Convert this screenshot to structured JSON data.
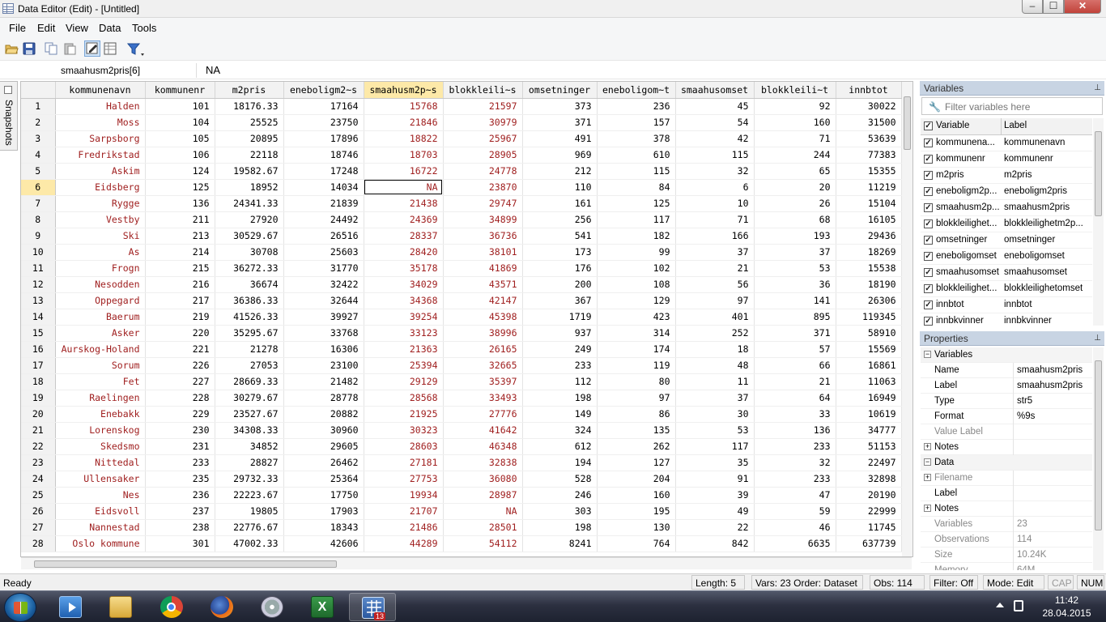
{
  "window": {
    "title": "Data Editor (Edit) - [Untitled]",
    "minimize_glyph": "–",
    "maximize_glyph": "☐",
    "close_glyph": "✕"
  },
  "menu": [
    "File",
    "Edit",
    "View",
    "Data",
    "Tools"
  ],
  "toolbar": {
    "icons": [
      "open-icon",
      "save-icon",
      "copy-icon",
      "paste-icon",
      "edit-mode-icon",
      "browse-mode-icon",
      "filter-icon"
    ]
  },
  "formula": {
    "varname": "smaahusm2pris[6]",
    "value": "NA"
  },
  "snapshots_label": "Snapshots",
  "grid": {
    "columns": [
      "kommunenavn",
      "kommunenr",
      "m2pris",
      "eneboligm2~s",
      "smaahusm2p~s",
      "blokkleili~s",
      "omsetninger",
      "eneboligom~t",
      "smaahusomset",
      "blokkleili~t",
      "innbtot"
    ],
    "selected_column": 4,
    "selected_row": 5,
    "rows": [
      [
        "1",
        "Halden",
        "101",
        "18176.33",
        "17164",
        "15768",
        "21597",
        "373",
        "236",
        "45",
        "92",
        "30022"
      ],
      [
        "2",
        "Moss",
        "104",
        "25525",
        "23750",
        "21846",
        "30979",
        "371",
        "157",
        "54",
        "160",
        "31500"
      ],
      [
        "3",
        "Sarpsborg",
        "105",
        "20895",
        "17896",
        "18822",
        "25967",
        "491",
        "378",
        "42",
        "71",
        "53639"
      ],
      [
        "4",
        "Fredrikstad",
        "106",
        "22118",
        "18746",
        "18703",
        "28905",
        "969",
        "610",
        "115",
        "244",
        "77383"
      ],
      [
        "5",
        "Askim",
        "124",
        "19582.67",
        "17248",
        "16722",
        "24778",
        "212",
        "115",
        "32",
        "65",
        "15355"
      ],
      [
        "6",
        "Eidsberg",
        "125",
        "18952",
        "14034",
        "NA",
        "23870",
        "110",
        "84",
        "6",
        "20",
        "11219"
      ],
      [
        "7",
        "Rygge",
        "136",
        "24341.33",
        "21839",
        "21438",
        "29747",
        "161",
        "125",
        "10",
        "26",
        "15104"
      ],
      [
        "8",
        "Vestby",
        "211",
        "27920",
        "24492",
        "24369",
        "34899",
        "256",
        "117",
        "71",
        "68",
        "16105"
      ],
      [
        "9",
        "Ski",
        "213",
        "30529.67",
        "26516",
        "28337",
        "36736",
        "541",
        "182",
        "166",
        "193",
        "29436"
      ],
      [
        "10",
        "As",
        "214",
        "30708",
        "25603",
        "28420",
        "38101",
        "173",
        "99",
        "37",
        "37",
        "18269"
      ],
      [
        "11",
        "Frogn",
        "215",
        "36272.33",
        "31770",
        "35178",
        "41869",
        "176",
        "102",
        "21",
        "53",
        "15538"
      ],
      [
        "12",
        "Nesodden",
        "216",
        "36674",
        "32422",
        "34029",
        "43571",
        "200",
        "108",
        "56",
        "36",
        "18190"
      ],
      [
        "13",
        "Oppegard",
        "217",
        "36386.33",
        "32644",
        "34368",
        "42147",
        "367",
        "129",
        "97",
        "141",
        "26306"
      ],
      [
        "14",
        "Baerum",
        "219",
        "41526.33",
        "39927",
        "39254",
        "45398",
        "1719",
        "423",
        "401",
        "895",
        "119345"
      ],
      [
        "15",
        "Asker",
        "220",
        "35295.67",
        "33768",
        "33123",
        "38996",
        "937",
        "314",
        "252",
        "371",
        "58910"
      ],
      [
        "16",
        "Aurskog-Holand",
        "221",
        "21278",
        "16306",
        "21363",
        "26165",
        "249",
        "174",
        "18",
        "57",
        "15569"
      ],
      [
        "17",
        "Sorum",
        "226",
        "27053",
        "23100",
        "25394",
        "32665",
        "233",
        "119",
        "48",
        "66",
        "16861"
      ],
      [
        "18",
        "Fet",
        "227",
        "28669.33",
        "21482",
        "29129",
        "35397",
        "112",
        "80",
        "11",
        "21",
        "11063"
      ],
      [
        "19",
        "Raelingen",
        "228",
        "30279.67",
        "28778",
        "28568",
        "33493",
        "198",
        "97",
        "37",
        "64",
        "16949"
      ],
      [
        "20",
        "Enebakk",
        "229",
        "23527.67",
        "20882",
        "21925",
        "27776",
        "149",
        "86",
        "30",
        "33",
        "10619"
      ],
      [
        "21",
        "Lorenskog",
        "230",
        "34308.33",
        "30960",
        "30323",
        "41642",
        "324",
        "135",
        "53",
        "136",
        "34777"
      ],
      [
        "22",
        "Skedsmo",
        "231",
        "34852",
        "29605",
        "28603",
        "46348",
        "612",
        "262",
        "117",
        "233",
        "51153"
      ],
      [
        "23",
        "Nittedal",
        "233",
        "28827",
        "26462",
        "27181",
        "32838",
        "194",
        "127",
        "35",
        "32",
        "22497"
      ],
      [
        "24",
        "Ullensaker",
        "235",
        "29732.33",
        "25364",
        "27753",
        "36080",
        "528",
        "204",
        "91",
        "233",
        "32898"
      ],
      [
        "25",
        "Nes",
        "236",
        "22223.67",
        "17750",
        "19934",
        "28987",
        "246",
        "160",
        "39",
        "47",
        "20190"
      ],
      [
        "26",
        "Eidsvoll",
        "237",
        "19805",
        "17903",
        "21707",
        "NA",
        "303",
        "195",
        "49",
        "59",
        "22999"
      ],
      [
        "27",
        "Nannestad",
        "238",
        "22776.67",
        "18343",
        "21486",
        "28501",
        "198",
        "130",
        "22",
        "46",
        "11745"
      ],
      [
        "28",
        "Oslo kommune",
        "301",
        "47002.33",
        "42606",
        "44289",
        "54112",
        "8241",
        "764",
        "842",
        "6635",
        "637739"
      ]
    ]
  },
  "variables_panel": {
    "title": "Variables",
    "pin_glyph": "⊥",
    "filter_placeholder": "Filter variables here",
    "col_variable": "Variable",
    "col_label": "Label",
    "check_glyph": "✓",
    "items": [
      {
        "name": "kommunena...",
        "label": "kommunenavn"
      },
      {
        "name": "kommunenr",
        "label": "kommunenr"
      },
      {
        "name": "m2pris",
        "label": "m2pris"
      },
      {
        "name": "eneboligm2p...",
        "label": "eneboligm2pris"
      },
      {
        "name": "smaahusm2p...",
        "label": "smaahusm2pris"
      },
      {
        "name": "blokkleilighet...",
        "label": "blokkleilighetm2p..."
      },
      {
        "name": "omsetninger",
        "label": "omsetninger"
      },
      {
        "name": "eneboligomset",
        "label": "eneboligomset"
      },
      {
        "name": "smaahusomset",
        "label": "smaahusomset"
      },
      {
        "name": "blokkleilighet...",
        "label": "blokkleilighetomset"
      },
      {
        "name": "innbtot",
        "label": "innbtot"
      },
      {
        "name": "innbkvinner",
        "label": "innbkvinner"
      }
    ]
  },
  "properties_panel": {
    "title": "Properties",
    "pin_glyph": "⊥",
    "collapse_glyph": "−",
    "expand_glyph": "+",
    "variables_group": "Variables",
    "var_props": [
      {
        "key": "Name",
        "value": "smaahusm2pris"
      },
      {
        "key": "Label",
        "value": "smaahusm2pris"
      },
      {
        "key": "Type",
        "value": "str5"
      },
      {
        "key": "Format",
        "value": "%9s"
      },
      {
        "key": "Value Label",
        "value": ""
      },
      {
        "key": "Notes",
        "value": ""
      }
    ],
    "data_group": "Data",
    "data_props": [
      {
        "key": "Filename",
        "value": ""
      },
      {
        "key": "Label",
        "value": ""
      },
      {
        "key": "Notes",
        "value": ""
      },
      {
        "key": "Variables",
        "value": "23"
      },
      {
        "key": "Observations",
        "value": "114"
      },
      {
        "key": "Size",
        "value": "10.24K"
      },
      {
        "key": "Memory",
        "value": "64M"
      }
    ]
  },
  "status": {
    "ready": "Ready",
    "length": "Length: 5",
    "vars": "Vars: 23  Order: Dataset",
    "obs": "Obs: 114",
    "filter": "Filter: Off",
    "mode": "Mode: Edit",
    "cap": "CAP",
    "num": "NUM"
  },
  "taskbar": {
    "apps": [
      "media-player-icon",
      "file-explorer-icon",
      "chrome-icon",
      "firefox-icon",
      "disc-app-icon",
      "excel-icon",
      "stata-icon"
    ],
    "stata_badge": "13",
    "time": "11:42",
    "date": "28.04.2015"
  }
}
